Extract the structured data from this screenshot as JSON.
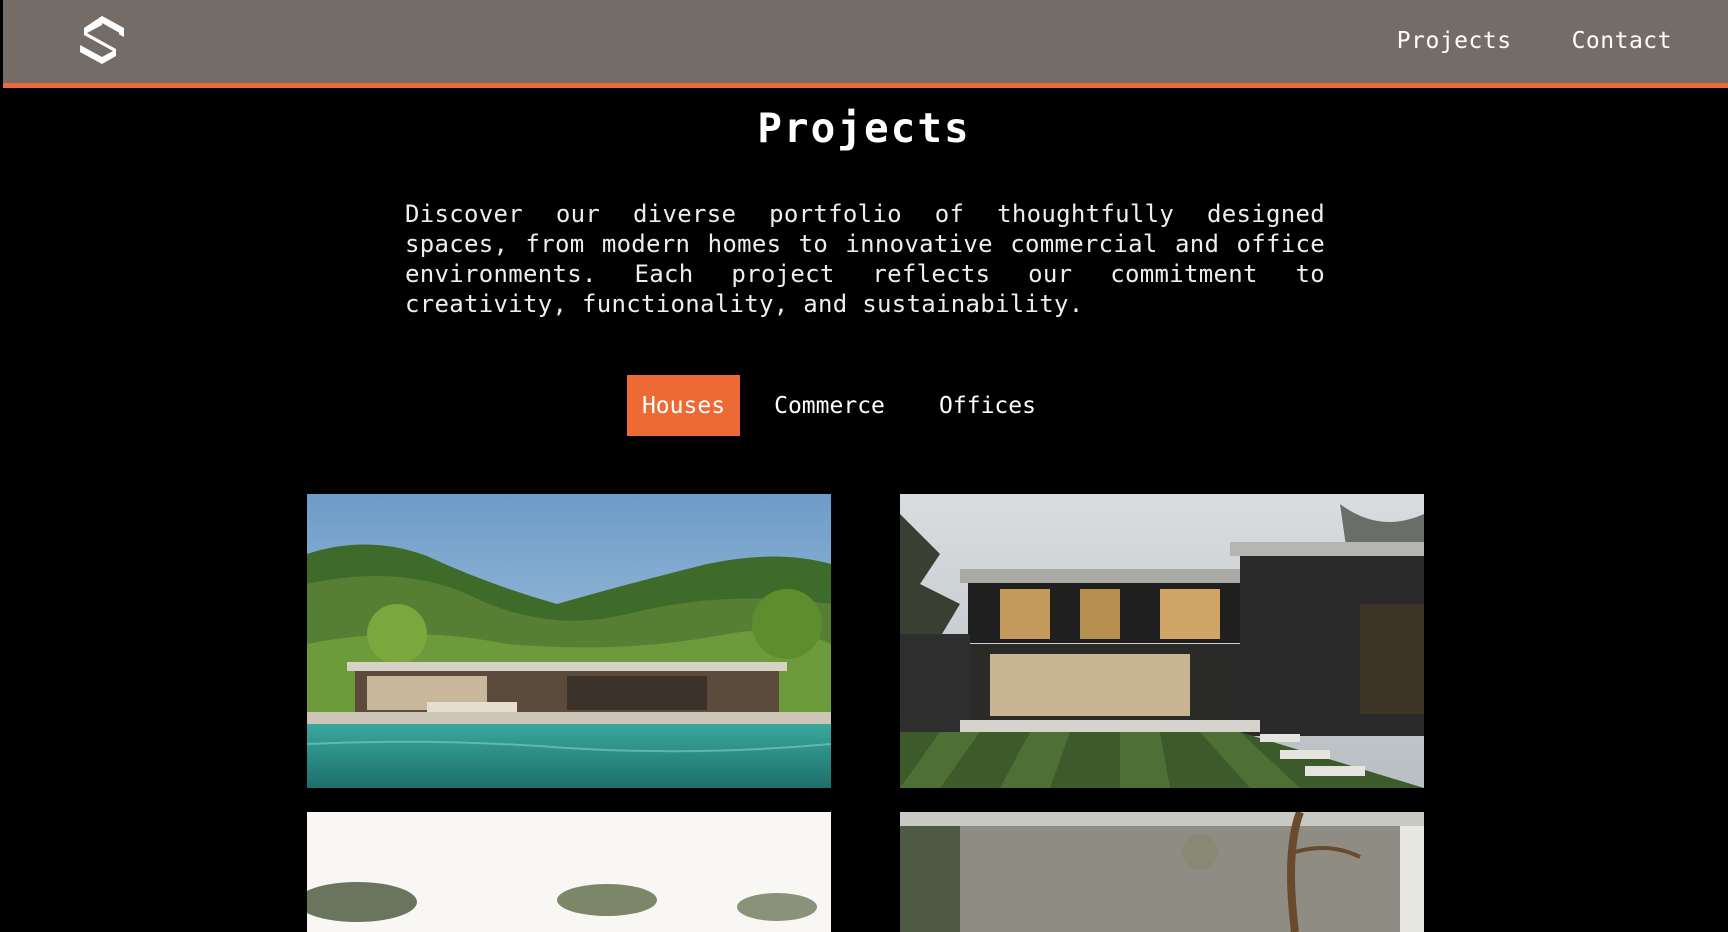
{
  "header": {
    "logo_icon": "s-hexagon-logo-icon",
    "nav": [
      {
        "label": "Projects"
      },
      {
        "label": "Contact"
      }
    ]
  },
  "main": {
    "title": "Projects",
    "intro": "Discover our diverse portfolio of thoughtfully designed spaces, from modern homes to innovative commercial and office environments. Each project reflects our commitment to creativity, functionality, and sustainability.",
    "tabs": [
      {
        "label": "Houses",
        "active": true
      },
      {
        "label": "Commerce",
        "active": false
      },
      {
        "label": "Offices",
        "active": false
      }
    ]
  },
  "colors": {
    "header_bg": "#746d67",
    "accent": "#ee6a35",
    "page_bg": "#000000"
  }
}
